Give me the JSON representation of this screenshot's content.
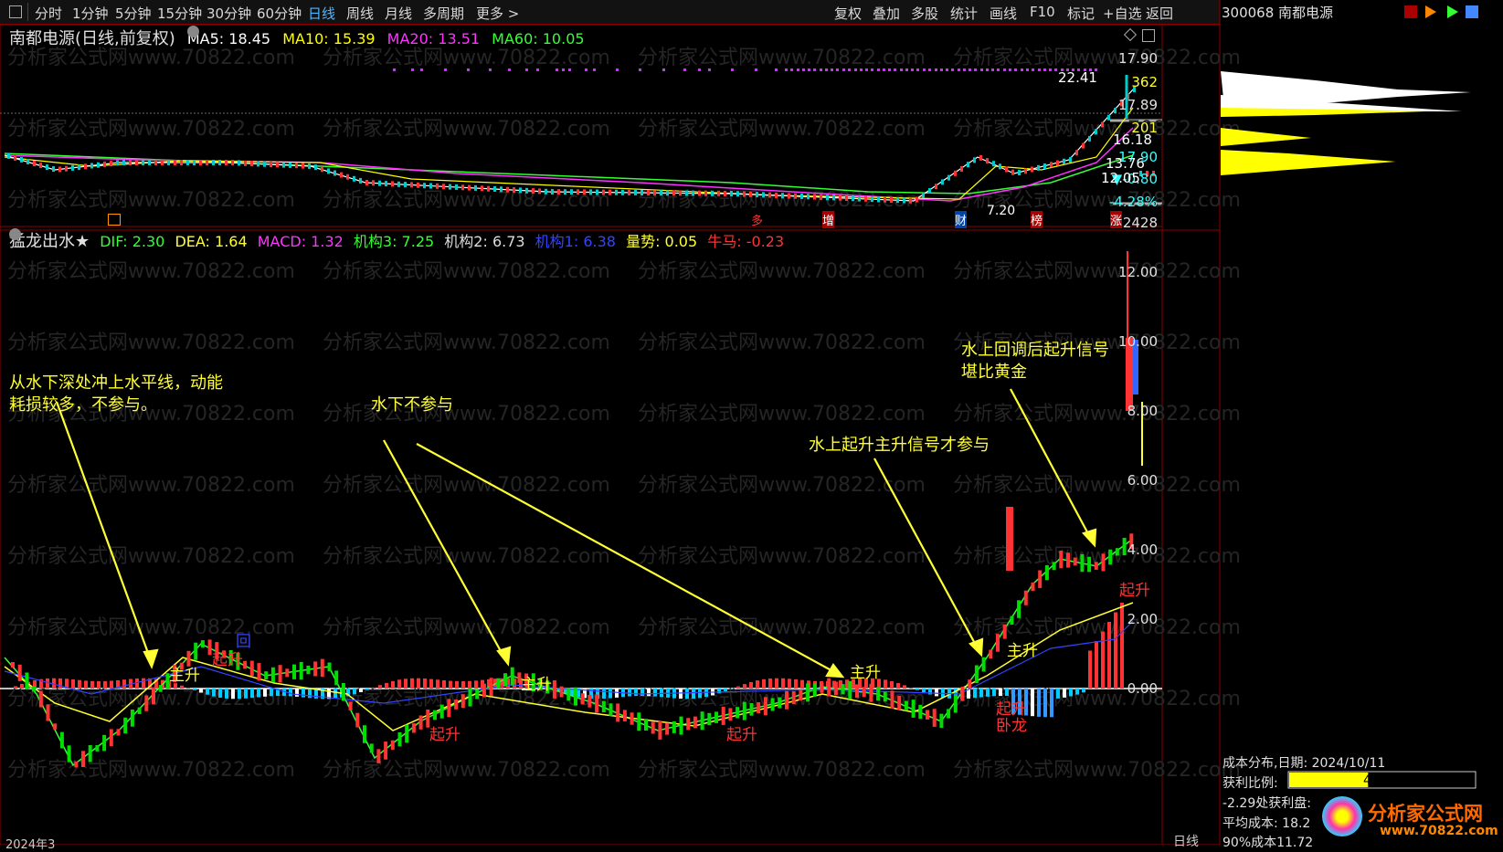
{
  "toolbar": {
    "period_tabs": [
      "分时",
      "1分钟",
      "5分钟",
      "15分钟",
      "30分钟",
      "60分钟",
      "日线",
      "周线",
      "月线",
      "多周期",
      "更多 >"
    ],
    "active_tab": "日线",
    "right_buttons": [
      "复权",
      "叠加",
      "多股",
      "统计",
      "画线",
      "F10",
      "标记",
      "+自选",
      "返回"
    ]
  },
  "stock": {
    "code_name": "300068 南都电源",
    "title": "南都电源(日线,前复权)"
  },
  "ma_legend": {
    "ma5": "MA5: 18.45",
    "ma10": "MA10: 15.39",
    "ma20": "MA20: 13.51",
    "ma60": "MA60: 10.05"
  },
  "indicator": {
    "name": "猛龙出水★",
    "dif": "DIF: 2.30",
    "dea": "DEA: 1.64",
    "macd": "MACD: 1.32",
    "jg3": "机构3: 7.25",
    "jg2": "机构2: 6.73",
    "jg1": "机构1: 6.38",
    "liang": "量势: 0.05",
    "niuma": "牛马: -0.23"
  },
  "price_axis": [
    "17.90",
    "362",
    "17.89",
    "201",
    "17.90",
    "▼-0.80",
    "-4.28%",
    "12428"
  ],
  "price_chart_labels": {
    "high": "22.41",
    "p1": "16.18",
    "p2": "13.76",
    "p3": "12.05",
    "low": "7.20"
  },
  "event_markers": [
    "多",
    "增",
    "财",
    "榜",
    "涨"
  ],
  "indicator_axis": [
    "12.00",
    "10.00",
    "8.00",
    "6.00",
    "4.00",
    "2.00",
    "0.00"
  ],
  "signals": [
    "主升",
    "起升",
    "回",
    "主升",
    "主升",
    "起升",
    "起升",
    "卧龙",
    "起升",
    "主升",
    "起升"
  ],
  "annotations": {
    "a1_l1": "从水下深处冲上水平线，动能",
    "a1_l2": "耗损较多，不参与。",
    "a2": "水下不参与",
    "a3": "水上起升主升信号才参与",
    "a4_l1": "水上回调后起升信号",
    "a4_l2": "堪比黄金"
  },
  "bottom": {
    "year": "2024年3",
    "period": "日线"
  },
  "cost_dist": {
    "date": "成本分布,日期: 2024/10/11",
    "profit_label": "获利比例:",
    "profit_value": "42.5%",
    "profit_ratio": 0.425,
    "line3": "-2.29处获利盘:",
    "line4": "平均成本: 18.2",
    "line5": "90%成本11.72"
  },
  "watermark": "分析家公式网www.70822.com",
  "logo": {
    "name": "分析家公式网",
    "url": "www.70822.com"
  },
  "colors": {
    "up": "#ff3333",
    "down": "#00cc00",
    "ma5": "#ffffff",
    "ma10": "#ffff00",
    "ma20": "#ff33ff",
    "ma60": "#33ff33",
    "accent": "#4fb6ff"
  }
}
